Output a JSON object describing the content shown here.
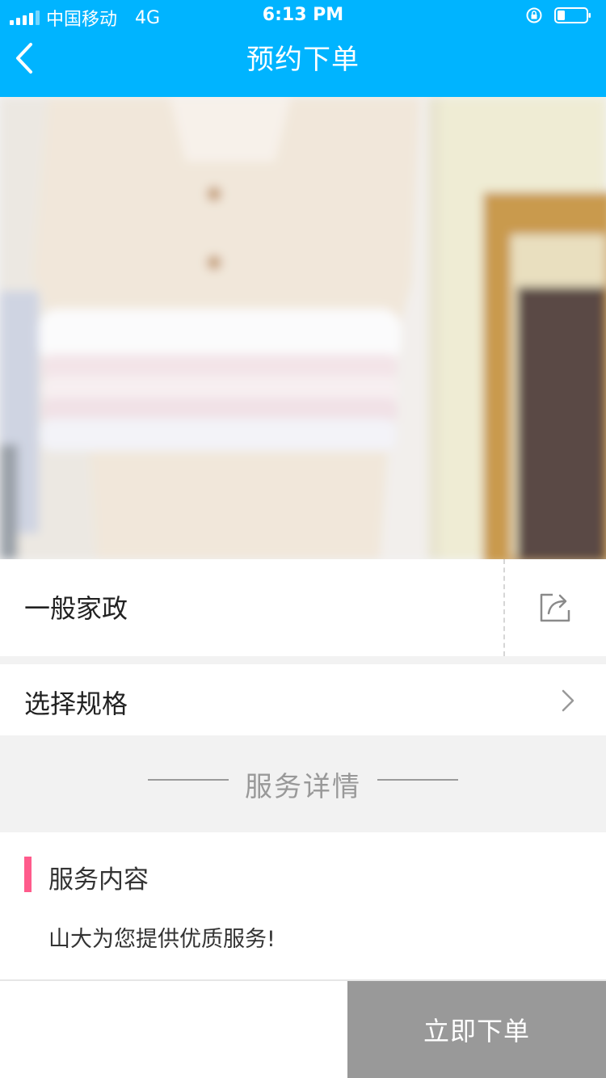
{
  "status_bar": {
    "carrier": "中国移动",
    "network": "4G",
    "time": "6:13 PM"
  },
  "header": {
    "title": "预约下单",
    "back_icon": "chevron-left-icon",
    "background": "#00b4ff"
  },
  "product": {
    "name": "一般家政",
    "share_icon": "share-icon"
  },
  "spec": {
    "label": "选择规格",
    "icon": "chevron-right-icon"
  },
  "section": {
    "title": "服务详情"
  },
  "content": {
    "title": "服务内容",
    "text": "山大为您提供优质服务!",
    "accent": "#ff5b8c"
  },
  "action": {
    "order_label": "立即下单",
    "button_color": "#999999"
  }
}
